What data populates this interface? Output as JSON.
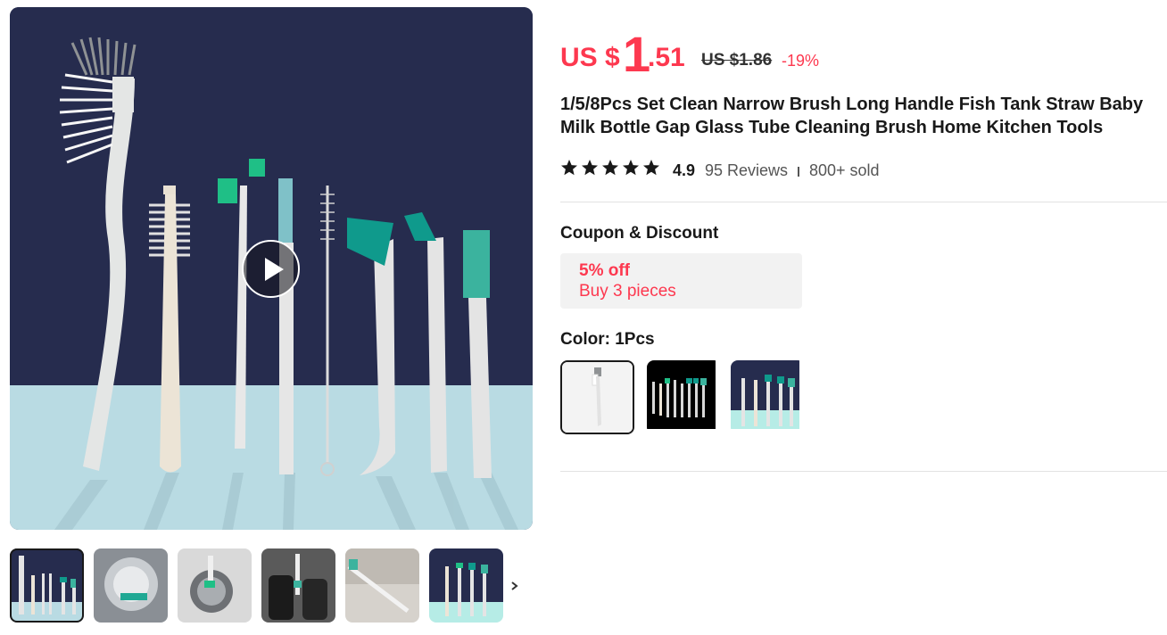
{
  "product": {
    "price": {
      "currency": "US $",
      "integer": "1",
      "decimal": ".51",
      "original": "US $1.86",
      "discount": "-19%",
      "accent_color": "#fd384f"
    },
    "title": "1/5/8Pcs Set Clean Narrow Brush Long Handle Fish Tank Straw Baby Milk Bottle Gap Glass Tube Cleaning Brush Home Kitchen Tools",
    "rating": {
      "value": "4.9",
      "stars": 5,
      "reviews": "95 Reviews",
      "sold": "800+ sold"
    }
  },
  "gallery": {
    "play_icon": "play-icon",
    "thumbnails": [
      {
        "name": "thumb-1",
        "active": true
      },
      {
        "name": "thumb-2",
        "active": false
      },
      {
        "name": "thumb-3",
        "active": false
      },
      {
        "name": "thumb-4",
        "active": false
      },
      {
        "name": "thumb-5",
        "active": false
      },
      {
        "name": "thumb-6",
        "active": false
      }
    ],
    "next_icon": "chevron-right-icon"
  },
  "coupon": {
    "section_label": "Coupon & Discount",
    "title": "5% off",
    "subtitle": "Buy 3 pieces"
  },
  "color": {
    "label": "Color: 1Pcs",
    "options": [
      {
        "name": "1Pcs",
        "selected": true
      },
      {
        "name": "option-2",
        "selected": false
      },
      {
        "name": "option-3",
        "selected": false
      }
    ]
  }
}
